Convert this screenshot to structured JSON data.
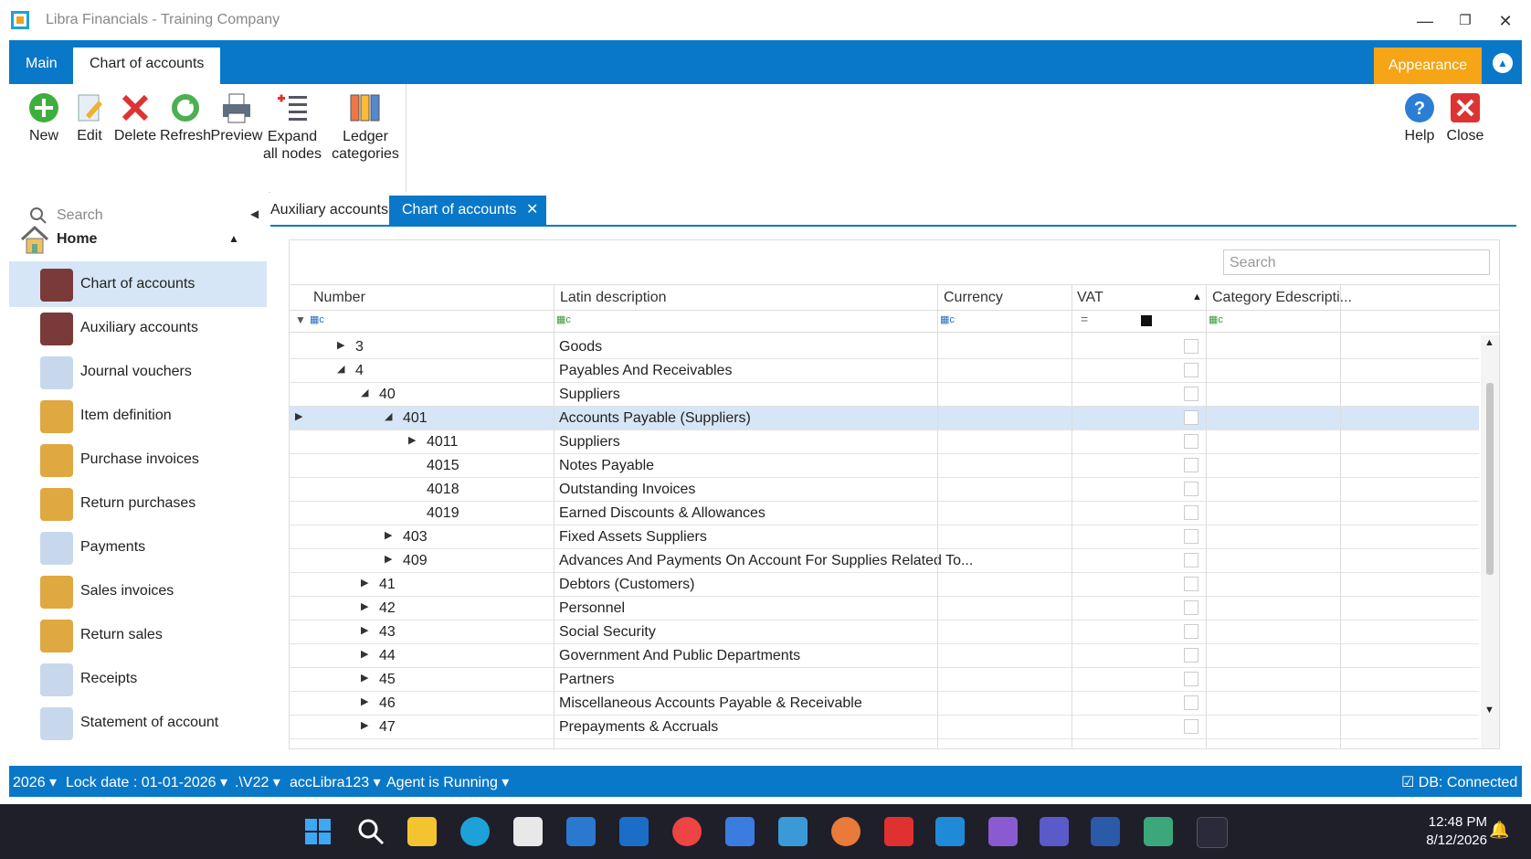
{
  "window": {
    "title": "Libra Financials - Training Company",
    "minimize": "—",
    "restore": "❐",
    "close": "✕"
  },
  "ribbon": {
    "tabs": [
      "Main",
      "Chart of accounts"
    ],
    "appearance_label": "Appearance"
  },
  "toolbar": {
    "buttons": [
      "New",
      "Edit",
      "Delete",
      "Refresh",
      "Preview",
      "Expand\nall nodes",
      "Ledger\ncategories"
    ],
    "help": "Help",
    "close": "Close"
  },
  "sidebar": {
    "search_placeholder": "Search",
    "home_label": "Home",
    "items": [
      "Chart of accounts",
      "Auxiliary accounts",
      "Journal vouchers",
      "Item definition",
      "Purchase invoices",
      "Return purchases",
      "Payments",
      "Sales invoices",
      "Return sales",
      "Receipts",
      "Statement of account"
    ]
  },
  "doc_tabs": [
    "Auxiliary accounts",
    "Chart of accounts"
  ],
  "grid": {
    "search_placeholder": "Search",
    "columns": [
      "Number",
      "Latin description",
      "Currency",
      "VAT",
      "Category Edescripti..."
    ],
    "rows": [
      {
        "number": "3",
        "description": "Goods"
      },
      {
        "number": "4",
        "description": "Payables And Receivables"
      },
      {
        "number": "40",
        "description": "Suppliers"
      },
      {
        "number": "401",
        "description": "Accounts Payable (Suppliers)"
      },
      {
        "number": "4011",
        "description": "Suppliers"
      },
      {
        "number": "4015",
        "description": "Notes Payable"
      },
      {
        "number": "4018",
        "description": "Outstanding Invoices"
      },
      {
        "number": "4019",
        "description": "Earned Discounts & Allowances"
      },
      {
        "number": "403",
        "description": "Fixed Assets Suppliers"
      },
      {
        "number": "409",
        "description": "Advances And Payments On Account For Supplies Related To..."
      },
      {
        "number": "41",
        "description": "Debtors (Customers)"
      },
      {
        "number": "42",
        "description": "Personnel"
      },
      {
        "number": "43",
        "description": "Social Security"
      },
      {
        "number": "44",
        "description": "Government And Public Departments"
      },
      {
        "number": "45",
        "description": "Partners"
      },
      {
        "number": "46",
        "description": "Miscellaneous Accounts Payable & Receivable"
      },
      {
        "number": "47",
        "description": "Prepayments & Accruals"
      }
    ]
  },
  "status": {
    "year": "2026",
    "lock_date": "Lock date : 01-01-2026",
    "server": ".\\V22",
    "db": "accLibra123",
    "agent": "Agent is Running",
    "connection": "DB: Connected"
  },
  "taskbar": {
    "time": "12:48 PM",
    "date": "8/12/2026"
  },
  "colors": {
    "accent": "#0a78c8",
    "appearance": "#f5a516",
    "selected_row": "#d6e6f6"
  }
}
